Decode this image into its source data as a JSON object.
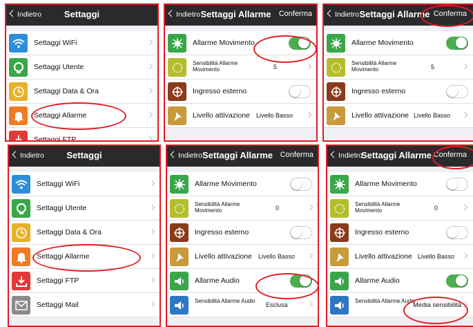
{
  "colors": {
    "accent_red": "#e01b24",
    "toggle_on": "#4cae50",
    "navbar": "#2a2a2c"
  },
  "settings_nav": {
    "back": "Indietro",
    "title": "Settaggi"
  },
  "alarm_nav": {
    "back": "Indietro",
    "title": "Settaggi Allarme",
    "confirm": "Conferma"
  },
  "settings_items": {
    "wifi": "Settaggi WiFi",
    "users": "Settaggi Utente",
    "datetime": "Settaggi Data & Ora",
    "alarms": "Settaggi Allarme",
    "ftp": "Settaggi FTP",
    "mail": "Settaggi Mail"
  },
  "alarm_items": {
    "motion": "Allarme Movimento",
    "motion_sens": "Sensibilità Allarme Movimento",
    "external": "Ingresso esterno",
    "level": "Livello attivazione",
    "audio": "Allarme Audio",
    "audio_sens": "Sensibilità Allarme Audio"
  },
  "values": {
    "sens_5": "5",
    "sens_0": "0",
    "level_low": "Livello Basso",
    "audio_excluded": "Esclusa",
    "audio_medium": "Media sensibilità"
  },
  "toggles": {
    "p2_motion": true,
    "p2_external": false,
    "p3_motion": true,
    "p3_external": false,
    "p5_motion": false,
    "p5_external": false,
    "p5_audio": true,
    "p6_motion": false,
    "p6_external": false,
    "p6_audio": true
  },
  "icons": [
    "wifi-icon",
    "user-icon",
    "clock-icon",
    "bell-icon",
    "download-icon",
    "mail-icon",
    "compass-icon",
    "sun-icon",
    "steering-wheel-icon",
    "pin-icon",
    "speaker-icon"
  ]
}
